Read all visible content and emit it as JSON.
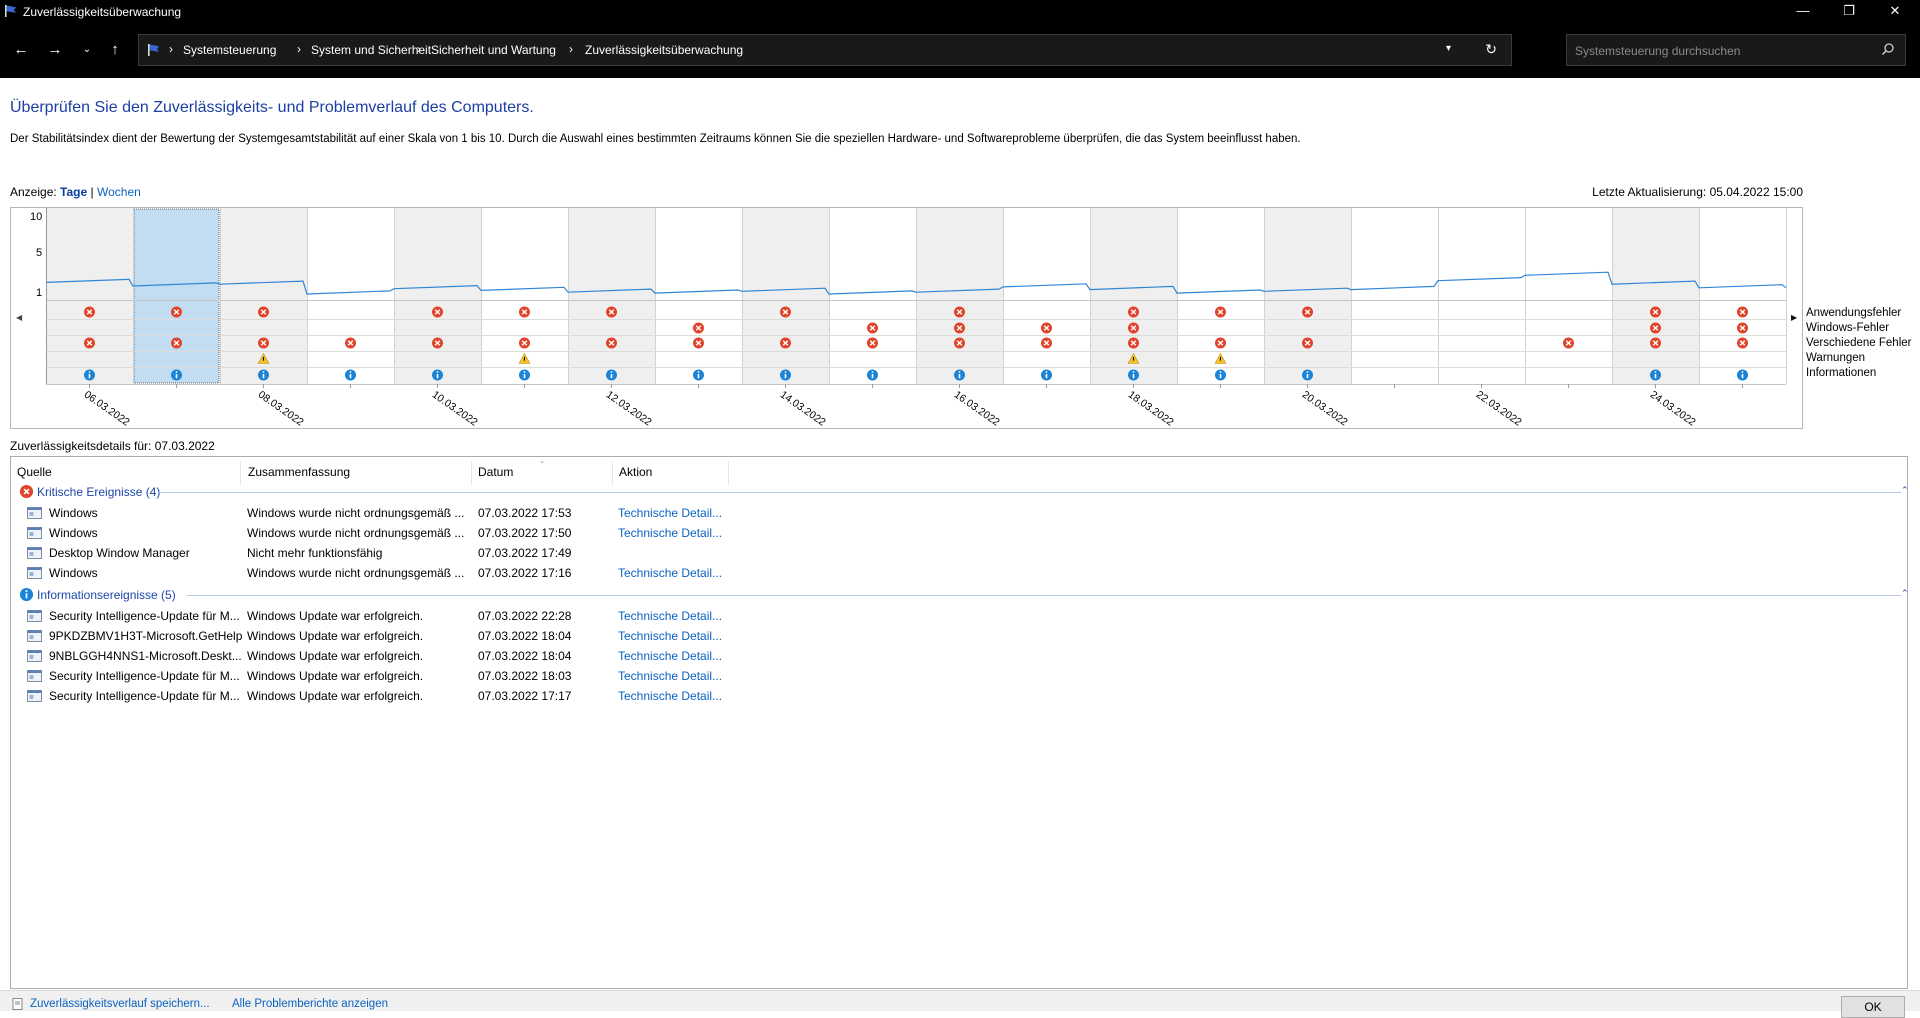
{
  "window": {
    "title": "Zuverlässigkeitsüberwachung",
    "controls": [
      "—",
      "❐",
      "✕"
    ]
  },
  "nav": {
    "breadcrumbs": [
      "Systemsteuerung",
      "System und Sicherheit",
      "Sicherheit und Wartung",
      "Zuverlässigkeitsüberwachung"
    ],
    "separator": "›",
    "search_placeholder": "Systemsteuerung durchsuchen",
    "icons": [
      "back-arrow-icon",
      "forward-arrow-icon",
      "recent-dropdown-icon",
      "up-arrow-icon",
      "control-panel-flag-icon",
      "address-dropdown-icon",
      "refresh-icon",
      "search-icon"
    ]
  },
  "page": {
    "heading": "Überprüfen Sie den Zuverlässigkeits- und Problemverlauf des Computers.",
    "description": "Der Stabilitätsindex dient der Bewertung der Systemgesamtstabilität auf einer Skala von 1 bis 10. Durch die Auswahl eines bestimmten Zeitraums können Sie die speziellen Hardware- und Softwareprobleme überprüfen, die das System beeinflusst haben.",
    "view_label": "Anzeige:",
    "view_days": "Tage",
    "view_sep": "|",
    "view_weeks": "Wochen",
    "last_update": "Letzte Aktualisierung: 05.04.2022 15:00",
    "details_for": "Zuverlässigkeitsdetails für: 07.03.2022"
  },
  "chart": {
    "yaxis_labels": [
      "10",
      "5",
      "1"
    ],
    "legend": [
      "Anwendungsfehler",
      "Windows-Fehler",
      "Verschiedene Fehler",
      "Warnungen",
      "Informationen"
    ],
    "dates": [
      "06.03.2022",
      "08.03.2022",
      "10.03.2022",
      "12.03.2022",
      "14.03.2022",
      "16.03.2022",
      "18.03.2022",
      "20.03.2022",
      "22.03.2022",
      "24.03.2022"
    ],
    "selected_column": 1,
    "shaded_columns": [
      0,
      2,
      4,
      6,
      8,
      10,
      12,
      14,
      18
    ],
    "stability": [
      2.3,
      1.9,
      2.1,
      1.0,
      1.6,
      1.4,
      1.2,
      1.1,
      1.3,
      1.0,
      1.2,
      1.8,
      1.5,
      1.1,
      1.3,
      1.5,
      2.5,
      3.1,
      2.1,
      1.7
    ],
    "events": {
      "app_errors": [
        0,
        1,
        2,
        4,
        5,
        6,
        8,
        10,
        12,
        13,
        14,
        18,
        19
      ],
      "windows_errors": [
        7,
        9,
        10,
        11,
        12,
        18,
        19
      ],
      "misc_errors": [
        0,
        1,
        2,
        3,
        4,
        5,
        6,
        7,
        8,
        9,
        10,
        11,
        12,
        13,
        14,
        17,
        18,
        19
      ],
      "warnings": [
        2,
        5,
        12,
        13
      ],
      "information": [
        0,
        1,
        2,
        3,
        4,
        5,
        6,
        7,
        8,
        9,
        10,
        11,
        12,
        13,
        14,
        18,
        19
      ]
    }
  },
  "table": {
    "columns": [
      "Quelle",
      "Zusammenfassung",
      "Datum",
      "Aktion"
    ],
    "groups": [
      {
        "label": "Kritische Ereignisse (4)",
        "icon": "critical-error-icon",
        "rows": [
          {
            "source": "Windows",
            "summary": "Windows wurde nicht ordnungsgemäß ...",
            "date": "07.03.2022 17:53",
            "action": "Technische Detail..."
          },
          {
            "source": "Windows",
            "summary": "Windows wurde nicht ordnungsgemäß ...",
            "date": "07.03.2022 17:50",
            "action": "Technische Detail..."
          },
          {
            "source": "Desktop Window Manager",
            "summary": "Nicht mehr funktionsfähig",
            "date": "07.03.2022 17:49",
            "action": ""
          },
          {
            "source": "Windows",
            "summary": "Windows wurde nicht ordnungsgemäß ...",
            "date": "07.03.2022 17:16",
            "action": "Technische Detail..."
          }
        ]
      },
      {
        "label": "Informationsereignisse (5)",
        "icon": "information-icon",
        "rows": [
          {
            "source": "Security Intelligence-Update für M...",
            "summary": "Windows Update war erfolgreich.",
            "date": "07.03.2022 22:28",
            "action": "Technische Detail..."
          },
          {
            "source": "9PKDZBMV1H3T-Microsoft.GetHelp",
            "summary": "Windows Update war erfolgreich.",
            "date": "07.03.2022 18:04",
            "action": "Technische Detail..."
          },
          {
            "source": "9NBLGGH4NNS1-Microsoft.Deskt...",
            "summary": "Windows Update war erfolgreich.",
            "date": "07.03.2022 18:04",
            "action": "Technische Detail..."
          },
          {
            "source": "Security Intelligence-Update für M...",
            "summary": "Windows Update war erfolgreich.",
            "date": "07.03.2022 18:03",
            "action": "Technische Detail..."
          },
          {
            "source": "Security Intelligence-Update für M...",
            "summary": "Windows Update war erfolgreich.",
            "date": "07.03.2022 17:17",
            "action": "Technische Detail..."
          }
        ]
      }
    ]
  },
  "footer": {
    "save_link": "Zuverlässigkeitsverlauf speichern...",
    "all_reports_link": "Alle Problemberichte anzeigen",
    "ok_button": "OK"
  },
  "colors": {
    "error": "#e0442b",
    "info": "#1a83d6",
    "warning": "#f2c12e",
    "selection": "#c2dcf2",
    "shade": "#efefef",
    "line": "#2f86d4",
    "link": "#0a62c2"
  }
}
